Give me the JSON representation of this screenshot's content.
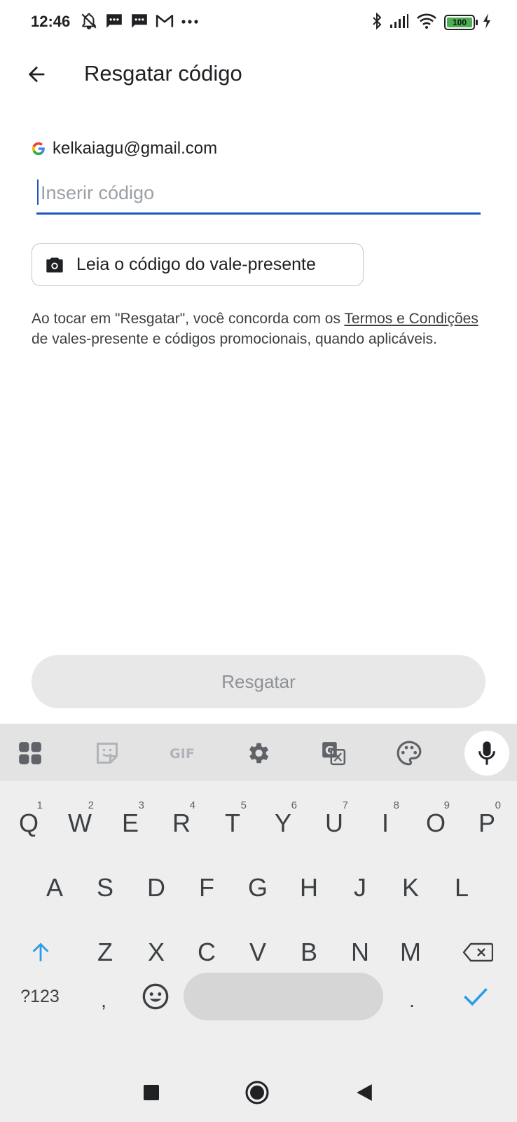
{
  "status_bar": {
    "time": "12:46",
    "battery": "100",
    "left_icons": [
      "mute-bell-icon",
      "message-icon",
      "message-icon",
      "gmail-icon",
      "more-dots-icon"
    ],
    "right_icons": [
      "bluetooth-icon",
      "signal-icon",
      "wifi-icon",
      "battery-icon",
      "charging-icon"
    ]
  },
  "app_bar": {
    "title": "Resgatar código"
  },
  "account": {
    "email": "kelkaiagu@gmail.com"
  },
  "code_input": {
    "placeholder": "Inserir código",
    "value": ""
  },
  "scan_button": {
    "label": "Leia o código do vale-presente"
  },
  "terms": {
    "prefix": "Ao tocar em \"Resgatar\", você concorda com os ",
    "link": "Termos e Condições",
    "suffix": " de vales-presente e códigos promocionais, quando aplicáveis."
  },
  "redeem_button": {
    "label": "Resgatar"
  },
  "keyboard": {
    "toolbar": [
      "apps-grid-icon",
      "sticker-icon",
      "gif-icon",
      "settings-gear-icon",
      "translate-icon",
      "palette-icon",
      "mic-icon"
    ],
    "row1": [
      {
        "k": "Q",
        "h": "1"
      },
      {
        "k": "W",
        "h": "2"
      },
      {
        "k": "E",
        "h": "3"
      },
      {
        "k": "R",
        "h": "4"
      },
      {
        "k": "T",
        "h": "5"
      },
      {
        "k": "Y",
        "h": "6"
      },
      {
        "k": "U",
        "h": "7"
      },
      {
        "k": "I",
        "h": "8"
      },
      {
        "k": "O",
        "h": "9"
      },
      {
        "k": "P",
        "h": "0"
      }
    ],
    "row2": [
      "A",
      "S",
      "D",
      "F",
      "G",
      "H",
      "J",
      "K",
      "L"
    ],
    "row3": [
      "Z",
      "X",
      "C",
      "V",
      "B",
      "N",
      "M"
    ],
    "symbols_label": "?123",
    "comma": ",",
    "period": "."
  },
  "colors": {
    "accent": "#1a56c4",
    "keyboard_bg": "#eeeeee",
    "toolbar_bg": "#e3e3e3",
    "key_accent": "#2a9de8"
  }
}
